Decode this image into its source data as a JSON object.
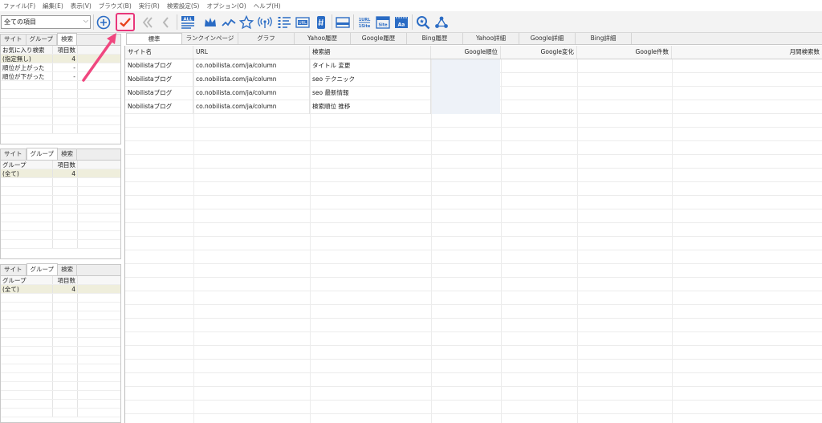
{
  "menu": [
    "ファイル(F)",
    "編集(E)",
    "表示(V)",
    "ブラウズ(B)",
    "実行(R)",
    "検索設定(S)",
    "オプション(O)",
    "ヘルプ(H)"
  ],
  "toolbar": {
    "combo_value": "全ての項目",
    "icons": [
      "add-circle-icon",
      "check-icon",
      "double-left-icon",
      "left-icon",
      "all-list-icon",
      "crown-icon",
      "trend-line-icon",
      "star-icon",
      "antenna-icon",
      "sort-list-icon",
      "url-icon",
      "hashtag-icon",
      "window-icon",
      "url-1site-icon",
      "site-icon",
      "aa-icon",
      "magnifier-icon",
      "network-icon"
    ],
    "labels": {
      "all": "ALL",
      "url": "URL",
      "url2": "1URL",
      "site2": "1Site",
      "site": "Site",
      "aa": "Aa"
    },
    "accent": "#e8367a"
  },
  "left_panels": [
    {
      "tabs": [
        "サイト",
        "グループ",
        "検索"
      ],
      "active_tab": 2,
      "header": [
        "お気に入り検索",
        "項目数"
      ],
      "rows": [
        [
          "(指定無し)",
          "4"
        ],
        [
          "順位が上がった",
          "-"
        ],
        [
          "順位が下がった",
          "-"
        ]
      ]
    },
    {
      "tabs": [
        "サイト",
        "グループ",
        "検索"
      ],
      "active_tab": 1,
      "header": [
        "グループ",
        "項目数"
      ],
      "rows": [
        [
          "(全て)",
          "4"
        ]
      ]
    },
    {
      "tabs": [
        "サイト",
        "グループ",
        "検索"
      ],
      "active_tab": 1,
      "header": [
        "グループ",
        "項目数"
      ],
      "rows": [
        [
          "(全て)",
          "4"
        ]
      ]
    }
  ],
  "main_tabs": [
    "標準",
    "ランクインページ",
    "グラフ",
    "Yahoo履歴",
    "Google履歴",
    "Bing履歴",
    "Yahoo詳細",
    "Google詳細",
    "Bing詳細"
  ],
  "main_table": {
    "columns": [
      "サイト名",
      "URL",
      "検索語",
      "Google順位",
      "Google変化",
      "Google件数",
      "月間検索数"
    ],
    "rows": [
      [
        "Nobilistaブログ",
        "co.nobilista.com/ja/column",
        "タイトル 変更",
        "",
        "",
        "",
        ""
      ],
      [
        "Nobilistaブログ",
        "co.nobilista.com/ja/column",
        "seo テクニック",
        "",
        "",
        "",
        ""
      ],
      [
        "Nobilistaブログ",
        "co.nobilista.com/ja/column",
        "seo 最新情報",
        "",
        "",
        "",
        ""
      ],
      [
        "Nobilistaブログ",
        "co.nobilista.com/ja/column",
        "検索順位 推移",
        "",
        "",
        "",
        ""
      ]
    ]
  }
}
